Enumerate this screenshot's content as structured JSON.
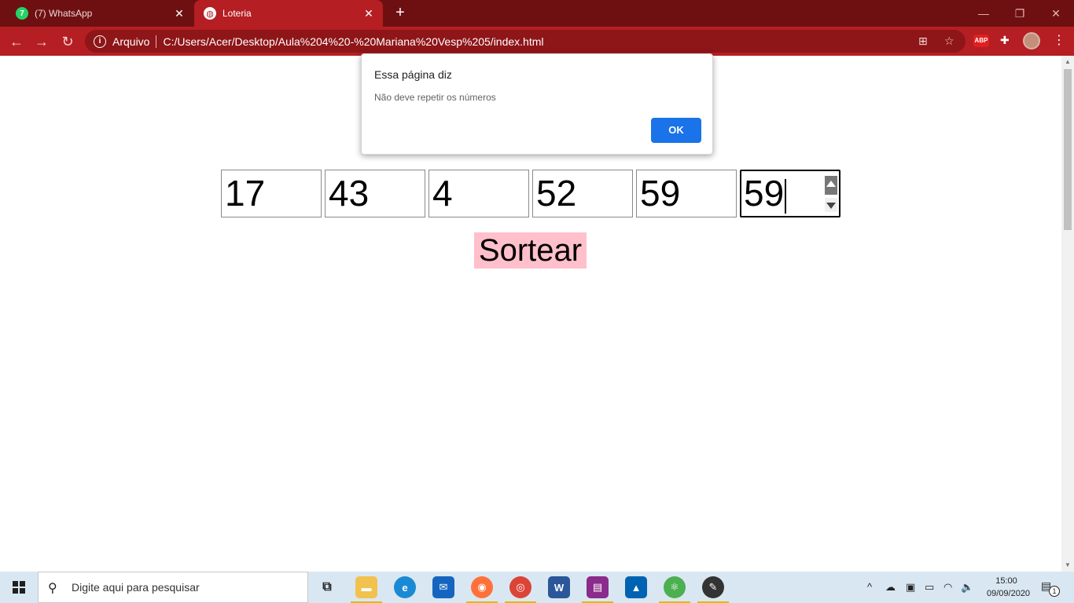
{
  "browser": {
    "tabs": [
      {
        "label": "(7) WhatsApp",
        "badge": "7",
        "active": false
      },
      {
        "label": "Loteria",
        "active": true
      }
    ],
    "new_tab": "+",
    "address": {
      "scheme_label": "Arquivo",
      "url": "C:/Users/Acer/Desktop/Aula%204%20-%20Mariana%20Vesp%205/index.html"
    },
    "extensions": {
      "adblock": "ABP"
    },
    "colors": {
      "frame": "#6e1012",
      "toolbar": "#b51e22",
      "omnibox": "#8e1518"
    }
  },
  "dialog": {
    "title": "Essa página diz",
    "message": "Não deve repetir os números",
    "ok_label": "OK",
    "ok_color": "#1a73e8"
  },
  "page": {
    "inputs": [
      "17",
      "43",
      "4",
      "52",
      "59",
      "59"
    ],
    "focused_input": 6,
    "button_label": "Sortear",
    "button_color": "#ffc0cb"
  },
  "taskbar": {
    "search_placeholder": "Digite aqui para pesquisar",
    "apps": [
      "task-view",
      "file-explorer",
      "edge",
      "mail",
      "firefox",
      "chrome",
      "word",
      "winrar",
      "photos",
      "atom",
      "snip-sketch"
    ],
    "clock": {
      "time": "15:00",
      "date": "09/09/2020"
    },
    "notifications": "1"
  }
}
